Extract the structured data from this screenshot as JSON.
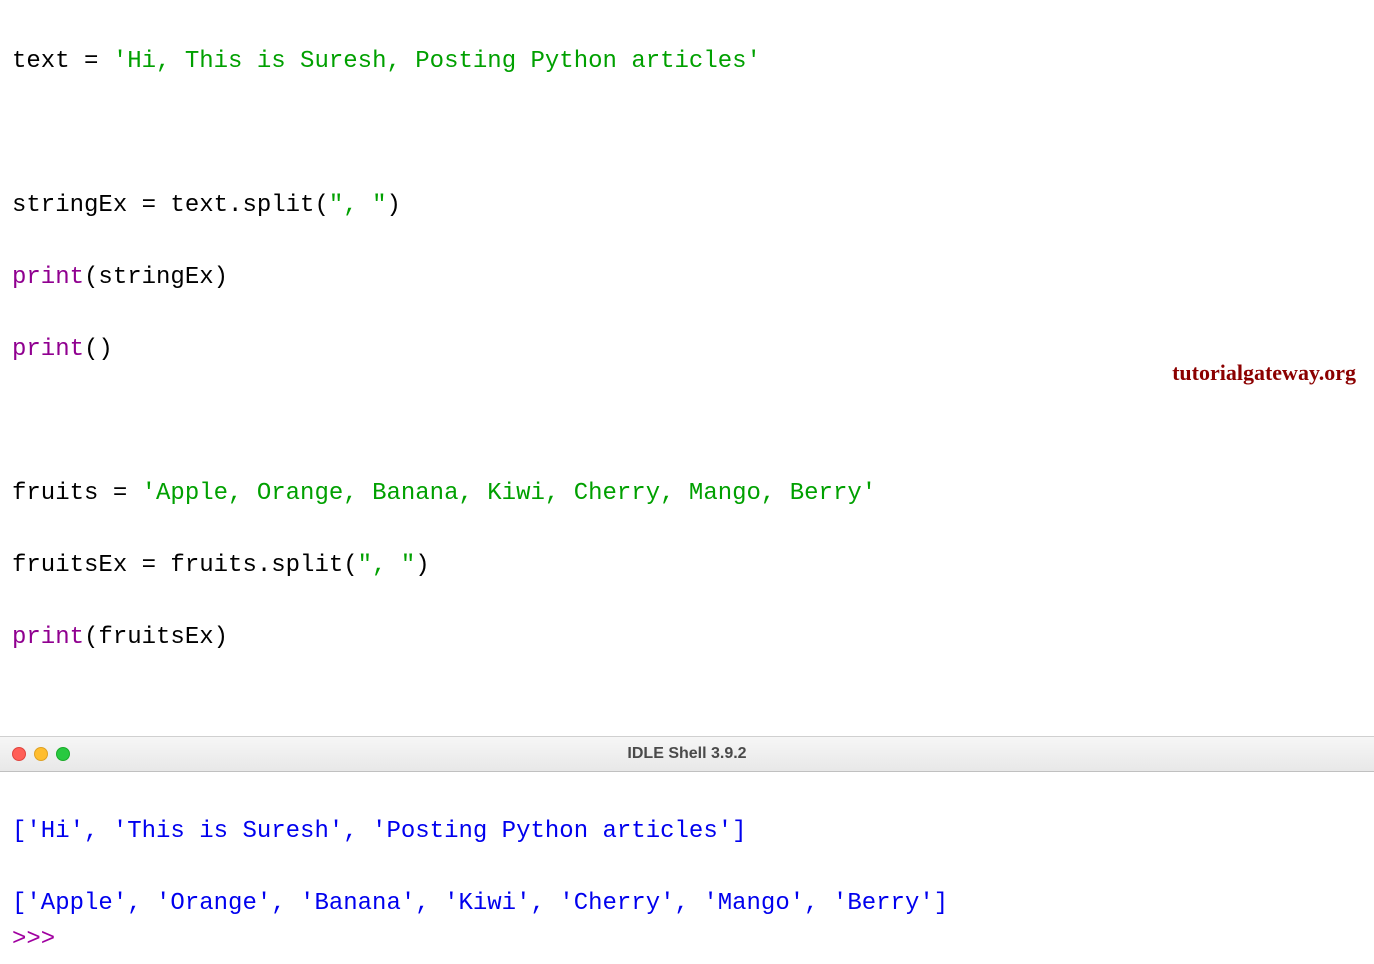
{
  "code": {
    "line1_var": "text ",
    "line1_eq": "= ",
    "line1_str": "'Hi, This is Suresh, Posting Python articles'",
    "line3_left": "stringEx = text.split(",
    "line3_arg": "\", \"",
    "line3_right": ")",
    "line4_print": "print",
    "line4_args": "(stringEx)",
    "line5_print": "print",
    "line5_args": "()",
    "line7_left": "fruits = ",
    "line7_str": "'Apple, Orange, Banana, Kiwi, Cherry, Mango, Berry'",
    "line8_left": "fruitsEx = fruits.split(",
    "line8_arg": "\", \"",
    "line8_right": ")",
    "line9_print": "print",
    "line9_args": "(fruitsEx)"
  },
  "watermark": "tutorialgateway.org",
  "titlebar": {
    "title": "IDLE Shell 3.9.2"
  },
  "output": {
    "line1": "['Hi', 'This is Suresh', 'Posting Python articles']",
    "line2": "",
    "line3": "['Apple', 'Orange', 'Banana', 'Kiwi', 'Cherry', 'Mango', 'Berry']",
    "prompt": ">>> "
  }
}
